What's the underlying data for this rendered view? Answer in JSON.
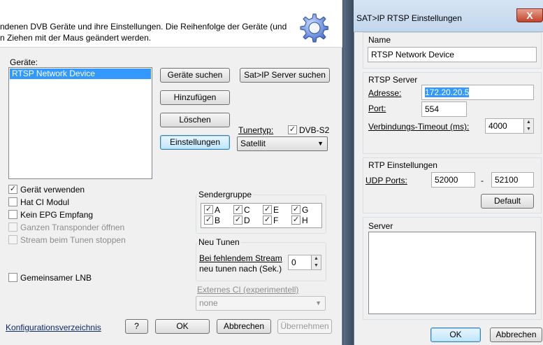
{
  "left_dialog": {
    "description_line1": "ndenen DVB Geräte und ihre Einstellungen. Die Reihenfolge der Geräte (und",
    "description_line2": "n Ziehen mit der Maus geändert werden.",
    "devices_label": "Geräte:",
    "devices": [
      "RTSP Network Device"
    ],
    "buttons": {
      "search_devices": "Geräte suchen",
      "satip_search": "Sat>IP Server suchen",
      "add": "Hinzufügen",
      "delete": "Löschen",
      "settings": "Einstellungen"
    },
    "tuner_type_label": "Tunertyp:",
    "dvbs2_label": "DVB-S2",
    "tuner_select_value": "Satellit",
    "checkboxes": [
      {
        "label": "Gerät verwenden",
        "checked": true,
        "enabled": true
      },
      {
        "label": "Hat CI Modul",
        "checked": false,
        "enabled": true
      },
      {
        "label": "Kein EPG Empfang",
        "checked": false,
        "enabled": true
      },
      {
        "label": "Ganzen Transponder öffnen",
        "checked": false,
        "enabled": false
      },
      {
        "label": "Stream beim Tunen stoppen",
        "checked": false,
        "enabled": false
      }
    ],
    "shared_lnb_label": "Gemeinsamer LNB",
    "sendergruppe_title": "Sendergruppe",
    "groups": [
      "A",
      "C",
      "E",
      "G",
      "B",
      "D",
      "F",
      "H"
    ],
    "neu_tunen_title": "Neu Tunen",
    "retune_label_line1": "Bei fehlendem Stream",
    "retune_label_line2": "neu tunen nach (Sek.)",
    "retune_value": "0",
    "external_ci_label": "Externes CI (experimentell)",
    "external_ci_value": "none",
    "config_dir_link": "Konfigurationsverzeichnis",
    "footer": {
      "help": "?",
      "ok": "OK",
      "cancel": "Abbrechen",
      "apply": "Übernehmen"
    }
  },
  "right_dialog": {
    "title": "SAT>IP RTSP Einstellungen",
    "close_glyph": "X",
    "name_label": "Name",
    "name_value": "RTSP Network Device",
    "rtsp_server_title": "RTSP Server",
    "address_label": "Adresse:",
    "address_value": "172.20.20.5",
    "port_label": "Port:",
    "port_value": "554",
    "timeout_label": "Verbindungs-Timeout (ms):",
    "timeout_value": "4000",
    "rtp_title": "RTP Einstellungen",
    "udp_label": "UDP Ports:",
    "udp_from": "52000",
    "udp_dash": "-",
    "udp_to": "52100",
    "default_button": "Default",
    "server_title": "Server",
    "ok_button": "OK",
    "cancel_button": "Abbrechen"
  },
  "colors": {
    "selection": "#3399ff",
    "desktop": "#3a4a5e"
  }
}
